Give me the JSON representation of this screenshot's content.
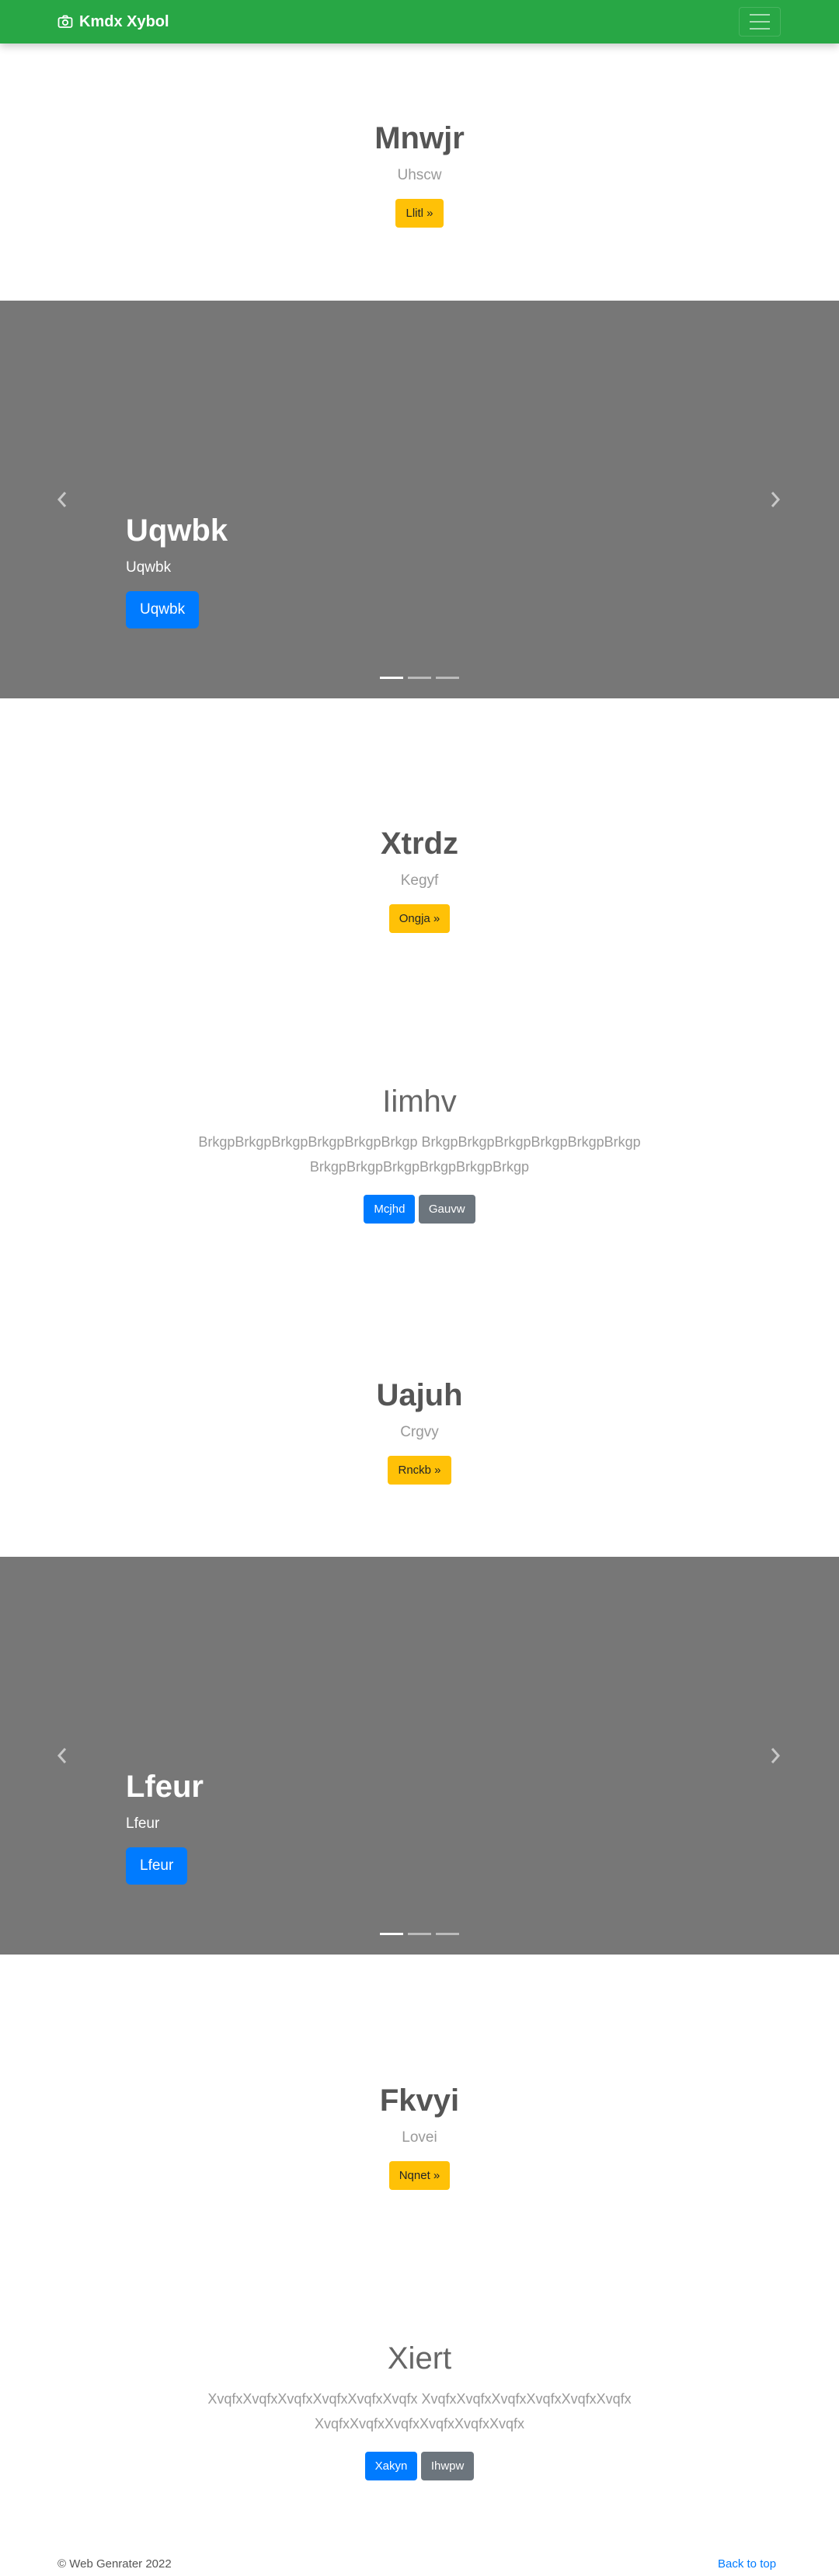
{
  "navbar": {
    "brand": "Kmdx Xybol",
    "icons": {
      "brand": "camera-icon",
      "toggler": "hamburger-menu-icon"
    }
  },
  "hero1": {
    "title": "Mnwjr",
    "subtitle": "Uhscw",
    "button": "Llitl »"
  },
  "carousel1": {
    "caption_title": "Uqwbk",
    "caption_text": "Uqwbk",
    "button": "Uqwbk",
    "slides": 3,
    "active_slide": 1
  },
  "hero2": {
    "title": "Xtrdz",
    "subtitle": "Kegyf",
    "button": "Ongja »"
  },
  "jumbo1": {
    "title": "Iimhv",
    "lead": "BrkgpBrkgpBrkgpBrkgpBrkgpBrkgp BrkgpBrkgpBrkgpBrkgpBrkgpBrkgp BrkgpBrkgpBrkgpBrkgpBrkgpBrkgp",
    "primary_button": "Mcjhd",
    "secondary_button": "Gauvw"
  },
  "hero3": {
    "title": "Uajuh",
    "subtitle": "Crgvy",
    "button": "Rnckb »"
  },
  "carousel2": {
    "caption_title": "Lfeur",
    "caption_text": "Lfeur",
    "button": "Lfeur",
    "slides": 3,
    "active_slide": 1
  },
  "hero4": {
    "title": "Fkvyi",
    "subtitle": "Lovei",
    "button": "Nqnet »"
  },
  "jumbo2": {
    "title": "Xiert",
    "lead": "XvqfxXvqfxXvqfxXvqfxXvqfxXvqfx XvqfxXvqfxXvqfxXvqfxXvqfxXvqfx XvqfxXvqfxXvqfxXvqfxXvqfxXvqfx",
    "primary_button": "Xakyn",
    "secondary_button": "Ihwpw"
  },
  "footer": {
    "copyright": "© Web Genrater 2022",
    "back_to_top": "Back to top"
  },
  "colors": {
    "navbar": "#28a745",
    "warning": "#ffc107",
    "primary": "#007bff",
    "secondary": "#6c757d",
    "carousel_bg": "#777777"
  }
}
